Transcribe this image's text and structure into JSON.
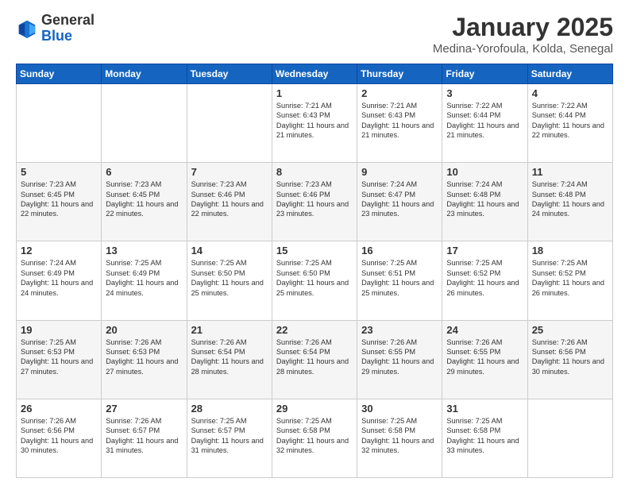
{
  "logo": {
    "general": "General",
    "blue": "Blue"
  },
  "title": {
    "month": "January 2025",
    "location": "Medina-Yorofoula, Kolda, Senegal"
  },
  "days_of_week": [
    "Sunday",
    "Monday",
    "Tuesday",
    "Wednesday",
    "Thursday",
    "Friday",
    "Saturday"
  ],
  "weeks": [
    [
      {
        "day": "",
        "sunrise": "",
        "sunset": "",
        "daylight": ""
      },
      {
        "day": "",
        "sunrise": "",
        "sunset": "",
        "daylight": ""
      },
      {
        "day": "",
        "sunrise": "",
        "sunset": "",
        "daylight": ""
      },
      {
        "day": "1",
        "sunrise": "Sunrise: 7:21 AM",
        "sunset": "Sunset: 6:43 PM",
        "daylight": "Daylight: 11 hours and 21 minutes."
      },
      {
        "day": "2",
        "sunrise": "Sunrise: 7:21 AM",
        "sunset": "Sunset: 6:43 PM",
        "daylight": "Daylight: 11 hours and 21 minutes."
      },
      {
        "day": "3",
        "sunrise": "Sunrise: 7:22 AM",
        "sunset": "Sunset: 6:44 PM",
        "daylight": "Daylight: 11 hours and 21 minutes."
      },
      {
        "day": "4",
        "sunrise": "Sunrise: 7:22 AM",
        "sunset": "Sunset: 6:44 PM",
        "daylight": "Daylight: 11 hours and 22 minutes."
      }
    ],
    [
      {
        "day": "5",
        "sunrise": "Sunrise: 7:23 AM",
        "sunset": "Sunset: 6:45 PM",
        "daylight": "Daylight: 11 hours and 22 minutes."
      },
      {
        "day": "6",
        "sunrise": "Sunrise: 7:23 AM",
        "sunset": "Sunset: 6:45 PM",
        "daylight": "Daylight: 11 hours and 22 minutes."
      },
      {
        "day": "7",
        "sunrise": "Sunrise: 7:23 AM",
        "sunset": "Sunset: 6:46 PM",
        "daylight": "Daylight: 11 hours and 22 minutes."
      },
      {
        "day": "8",
        "sunrise": "Sunrise: 7:23 AM",
        "sunset": "Sunset: 6:46 PM",
        "daylight": "Daylight: 11 hours and 23 minutes."
      },
      {
        "day": "9",
        "sunrise": "Sunrise: 7:24 AM",
        "sunset": "Sunset: 6:47 PM",
        "daylight": "Daylight: 11 hours and 23 minutes."
      },
      {
        "day": "10",
        "sunrise": "Sunrise: 7:24 AM",
        "sunset": "Sunset: 6:48 PM",
        "daylight": "Daylight: 11 hours and 23 minutes."
      },
      {
        "day": "11",
        "sunrise": "Sunrise: 7:24 AM",
        "sunset": "Sunset: 6:48 PM",
        "daylight": "Daylight: 11 hours and 24 minutes."
      }
    ],
    [
      {
        "day": "12",
        "sunrise": "Sunrise: 7:24 AM",
        "sunset": "Sunset: 6:49 PM",
        "daylight": "Daylight: 11 hours and 24 minutes."
      },
      {
        "day": "13",
        "sunrise": "Sunrise: 7:25 AM",
        "sunset": "Sunset: 6:49 PM",
        "daylight": "Daylight: 11 hours and 24 minutes."
      },
      {
        "day": "14",
        "sunrise": "Sunrise: 7:25 AM",
        "sunset": "Sunset: 6:50 PM",
        "daylight": "Daylight: 11 hours and 25 minutes."
      },
      {
        "day": "15",
        "sunrise": "Sunrise: 7:25 AM",
        "sunset": "Sunset: 6:50 PM",
        "daylight": "Daylight: 11 hours and 25 minutes."
      },
      {
        "day": "16",
        "sunrise": "Sunrise: 7:25 AM",
        "sunset": "Sunset: 6:51 PM",
        "daylight": "Daylight: 11 hours and 25 minutes."
      },
      {
        "day": "17",
        "sunrise": "Sunrise: 7:25 AM",
        "sunset": "Sunset: 6:52 PM",
        "daylight": "Daylight: 11 hours and 26 minutes."
      },
      {
        "day": "18",
        "sunrise": "Sunrise: 7:25 AM",
        "sunset": "Sunset: 6:52 PM",
        "daylight": "Daylight: 11 hours and 26 minutes."
      }
    ],
    [
      {
        "day": "19",
        "sunrise": "Sunrise: 7:25 AM",
        "sunset": "Sunset: 6:53 PM",
        "daylight": "Daylight: 11 hours and 27 minutes."
      },
      {
        "day": "20",
        "sunrise": "Sunrise: 7:26 AM",
        "sunset": "Sunset: 6:53 PM",
        "daylight": "Daylight: 11 hours and 27 minutes."
      },
      {
        "day": "21",
        "sunrise": "Sunrise: 7:26 AM",
        "sunset": "Sunset: 6:54 PM",
        "daylight": "Daylight: 11 hours and 28 minutes."
      },
      {
        "day": "22",
        "sunrise": "Sunrise: 7:26 AM",
        "sunset": "Sunset: 6:54 PM",
        "daylight": "Daylight: 11 hours and 28 minutes."
      },
      {
        "day": "23",
        "sunrise": "Sunrise: 7:26 AM",
        "sunset": "Sunset: 6:55 PM",
        "daylight": "Daylight: 11 hours and 29 minutes."
      },
      {
        "day": "24",
        "sunrise": "Sunrise: 7:26 AM",
        "sunset": "Sunset: 6:55 PM",
        "daylight": "Daylight: 11 hours and 29 minutes."
      },
      {
        "day": "25",
        "sunrise": "Sunrise: 7:26 AM",
        "sunset": "Sunset: 6:56 PM",
        "daylight": "Daylight: 11 hours and 30 minutes."
      }
    ],
    [
      {
        "day": "26",
        "sunrise": "Sunrise: 7:26 AM",
        "sunset": "Sunset: 6:56 PM",
        "daylight": "Daylight: 11 hours and 30 minutes."
      },
      {
        "day": "27",
        "sunrise": "Sunrise: 7:26 AM",
        "sunset": "Sunset: 6:57 PM",
        "daylight": "Daylight: 11 hours and 31 minutes."
      },
      {
        "day": "28",
        "sunrise": "Sunrise: 7:25 AM",
        "sunset": "Sunset: 6:57 PM",
        "daylight": "Daylight: 11 hours and 31 minutes."
      },
      {
        "day": "29",
        "sunrise": "Sunrise: 7:25 AM",
        "sunset": "Sunset: 6:58 PM",
        "daylight": "Daylight: 11 hours and 32 minutes."
      },
      {
        "day": "30",
        "sunrise": "Sunrise: 7:25 AM",
        "sunset": "Sunset: 6:58 PM",
        "daylight": "Daylight: 11 hours and 32 minutes."
      },
      {
        "day": "31",
        "sunrise": "Sunrise: 7:25 AM",
        "sunset": "Sunset: 6:58 PM",
        "daylight": "Daylight: 11 hours and 33 minutes."
      },
      {
        "day": "",
        "sunrise": "",
        "sunset": "",
        "daylight": ""
      }
    ]
  ]
}
